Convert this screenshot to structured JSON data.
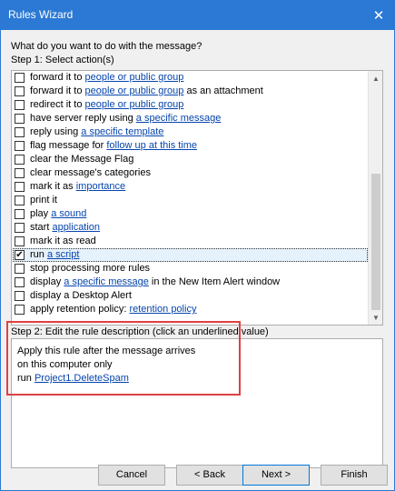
{
  "window": {
    "title": "Rules Wizard",
    "close_glyph": "✕"
  },
  "question": "What do you want to do with the message?",
  "step1": "Step 1: Select action(s)",
  "actions": [
    {
      "pre": "forward it to ",
      "link": "people or public group",
      "post": "",
      "checked": false
    },
    {
      "pre": "forward it to ",
      "link": "people or public group",
      "post": " as an attachment",
      "checked": false
    },
    {
      "pre": "redirect it to ",
      "link": "people or public group",
      "post": "",
      "checked": false
    },
    {
      "pre": "have server reply using ",
      "link": "a specific message",
      "post": "",
      "checked": false
    },
    {
      "pre": "reply using ",
      "link": "a specific template",
      "post": "",
      "checked": false
    },
    {
      "pre": "flag message for ",
      "link": "follow up at this time",
      "post": "",
      "checked": false
    },
    {
      "pre": "clear the Message Flag",
      "link": "",
      "post": "",
      "checked": false
    },
    {
      "pre": "clear message's categories",
      "link": "",
      "post": "",
      "checked": false
    },
    {
      "pre": "mark it as ",
      "link": "importance",
      "post": "",
      "checked": false
    },
    {
      "pre": "print it",
      "link": "",
      "post": "",
      "checked": false
    },
    {
      "pre": "play ",
      "link": "a sound",
      "post": "",
      "checked": false
    },
    {
      "pre": "start ",
      "link": "application",
      "post": "",
      "checked": false
    },
    {
      "pre": "mark it as read",
      "link": "",
      "post": "",
      "checked": false
    },
    {
      "pre": "run ",
      "link": "a script",
      "post": "",
      "checked": true
    },
    {
      "pre": "stop processing more rules",
      "link": "",
      "post": "",
      "checked": false
    },
    {
      "pre": "display ",
      "link": "a specific message",
      "post": " in the New Item Alert window",
      "checked": false
    },
    {
      "pre": "display a Desktop Alert",
      "link": "",
      "post": "",
      "checked": false
    },
    {
      "pre": "apply retention policy: ",
      "link": "retention policy",
      "post": "",
      "checked": false
    }
  ],
  "step2": "Step 2: Edit the rule description (click an underlined value)",
  "description": {
    "line1": "Apply this rule after the message arrives",
    "line2": "on this computer only",
    "line3_pre": "run ",
    "line3_link": "Project1.DeleteSpam"
  },
  "buttons": {
    "cancel": "Cancel",
    "back": "< Back",
    "next": "Next >",
    "finish": "Finish"
  },
  "checkmark": "✔",
  "colors": {
    "titlebar": "#2b79d4",
    "link": "#0645ad",
    "highlight": "#e04040"
  }
}
